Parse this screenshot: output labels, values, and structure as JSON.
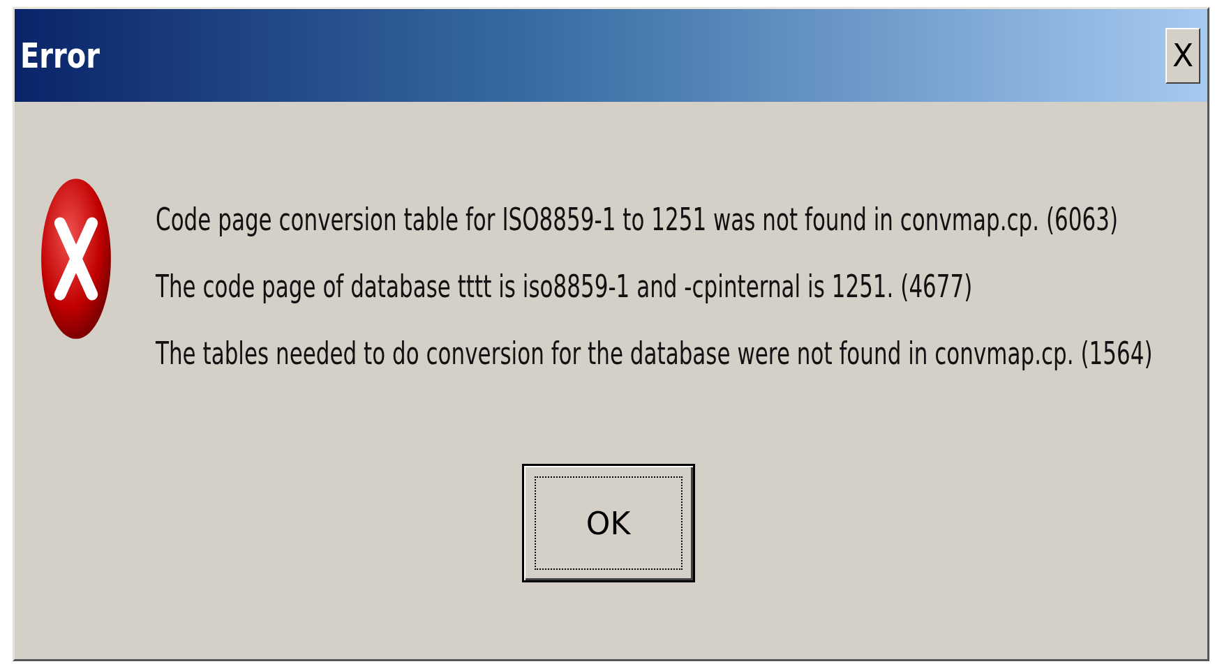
{
  "window": {
    "title": "Error",
    "close": "X"
  },
  "messages": [
    "Code page conversion table for ISO8859-1 to 1251 was not found in convmap.cp. (6063)",
    "The code page of database tttt is iso8859-1 and -cpinternal is 1251. (4677)",
    "The tables needed to do conversion for the database were not found in convmap.cp. (1564)"
  ],
  "buttons": [
    {
      "label": "OK",
      "focused": true
    }
  ]
}
